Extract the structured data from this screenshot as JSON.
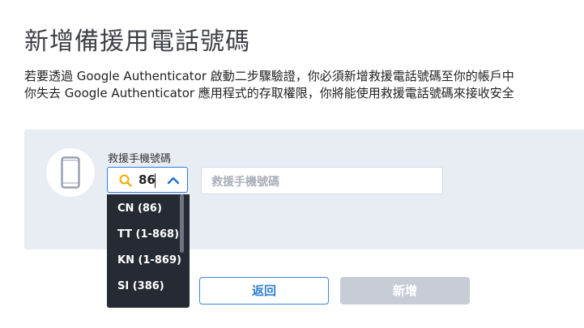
{
  "page": {
    "title": "新增備援用電話號碼",
    "description_line1": "若要透過 Google Authenticator 啟動二步驟驗證，你必須新增救援電話號碼至你的帳戶中",
    "description_line2": "你失去 Google Authenticator 應用程式的存取權限，你將能使用救援電話號碼來接收安全"
  },
  "form": {
    "field_label": "救援手機號碼",
    "country_search_value": "86",
    "phone_placeholder": "救援手機號碼",
    "country_options": [
      {
        "label": "CN (86)"
      },
      {
        "label": "TT (1-868)"
      },
      {
        "label": "KN (1-869)"
      },
      {
        "label": "SI (386)"
      }
    ]
  },
  "buttons": {
    "back_label": "返回",
    "add_label": "新增"
  },
  "colors": {
    "accent": "#2a7de1",
    "panel_bg": "#e8ecf3",
    "dropdown_bg": "#252a33",
    "search_icon": "#f2a900",
    "disabled_button": "#c7ccd5"
  },
  "icons": {
    "phone": "mobile-phone-icon",
    "search": "search-icon",
    "chevron": "chevron-up-icon"
  }
}
